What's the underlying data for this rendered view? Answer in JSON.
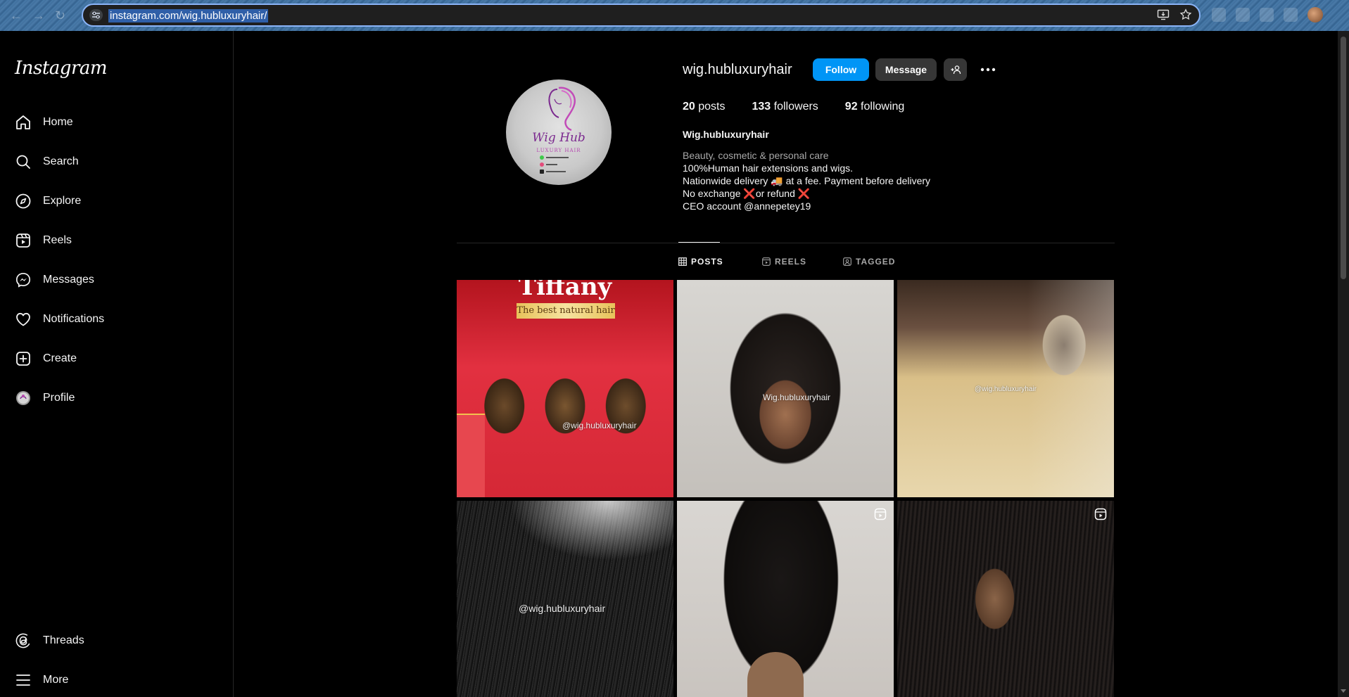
{
  "browser": {
    "url": "instagram.com/wig.hubluxuryhair/"
  },
  "sidebar": {
    "logo": "Instagram",
    "items": [
      {
        "label": "Home",
        "icon": "home-icon"
      },
      {
        "label": "Search",
        "icon": "search-icon"
      },
      {
        "label": "Explore",
        "icon": "compass-icon"
      },
      {
        "label": "Reels",
        "icon": "reels-icon"
      },
      {
        "label": "Messages",
        "icon": "messenger-icon"
      },
      {
        "label": "Notifications",
        "icon": "heart-icon"
      },
      {
        "label": "Create",
        "icon": "plus-square-icon"
      },
      {
        "label": "Profile",
        "icon": "profile-avatar-icon"
      }
    ],
    "bottom_items": [
      {
        "label": "Threads",
        "icon": "threads-icon"
      },
      {
        "label": "More",
        "icon": "hamburger-icon"
      }
    ]
  },
  "profile": {
    "username": "wig.hubluxuryhair",
    "avatar_text": {
      "main": "Wig Hub",
      "sub": "LUXURY HAIR"
    },
    "buttons": {
      "follow": "Follow",
      "message": "Message"
    },
    "stats": {
      "posts_count": "20",
      "posts_label": "posts",
      "followers_count": "133",
      "followers_label": "followers",
      "following_count": "92",
      "following_label": "following"
    },
    "full_name": "Wig.hubluxuryhair",
    "category": "Beauty, cosmetic & personal care",
    "bio": {
      "line1": "100%Human hair extensions and wigs.",
      "line2_a": "Nationwide delivery 🚚  at a fee. Payment before delivery",
      "line3_a": "No exchange ",
      "line3_x1": "❌",
      "line3_b": "or refund ",
      "line3_x2": "❌",
      "line4": "CEO account @annepetey19"
    }
  },
  "tabs": [
    {
      "label": "POSTS",
      "active": true
    },
    {
      "label": "REELS",
      "active": false
    },
    {
      "label": "TAGGED",
      "active": false
    }
  ],
  "posts": [
    {
      "watermark": "@wig.hubluxuryhair",
      "banner": "Tiffany",
      "strip": "The best natural hair",
      "is_reel": false
    },
    {
      "watermark": "Wig.hubluxuryhair",
      "is_reel": false
    },
    {
      "watermark": "@wig.hubluxuryhair",
      "is_reel": false
    },
    {
      "watermark": "@wig.hubluxuryhair",
      "is_reel": false
    },
    {
      "watermark": "",
      "is_reel": true
    },
    {
      "watermark": "",
      "is_reel": true
    }
  ],
  "colors": {
    "follow_button": "#0095f6",
    "secondary_button": "#363636",
    "background": "#000000",
    "text_secondary": "#a8a8a8"
  }
}
